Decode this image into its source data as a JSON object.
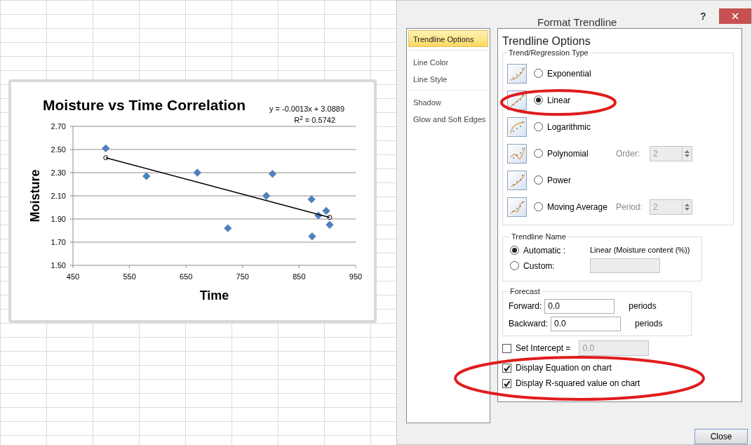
{
  "chart": {
    "title": "Moisture vs Time Correlation",
    "equation": "y = -0.0013x + 3.0889",
    "r_squared": "R$^{2}$ = 0.5742",
    "chart_data": {
      "type": "scatter",
      "xlabel": "Time",
      "ylabel": "Moisture",
      "xlim": [
        450,
        950
      ],
      "ylim": [
        1.5,
        2.7
      ],
      "xticks": [
        450,
        550,
        650,
        750,
        850,
        950
      ],
      "yticks": [
        {
          "value": 1.5,
          "label": "1.50"
        },
        {
          "value": 1.7,
          "label": "1.70"
        },
        {
          "value": 1.9,
          "label": "1.90"
        },
        {
          "value": 2.1,
          "label": "2.10"
        },
        {
          "value": 2.3,
          "label": "2.30"
        },
        {
          "value": 2.5,
          "label": "2.50"
        },
        {
          "value": 2.7,
          "label": "2.70"
        }
      ],
      "x": [
        508,
        580,
        670,
        724,
        792,
        803,
        872,
        873,
        884,
        898,
        904
      ],
      "grid": true,
      "series": [
        {
          "color": "#4f81bd",
          "values": [
            2.51,
            2.27,
            2.3,
            1.82,
            2.1,
            2.29,
            2.07,
            1.75,
            1.93,
            1.97,
            1.85
          ]
        },
        {
          "color": "#000000",
          "values": [
            2.429,
            null,
            null,
            null,
            null,
            null,
            null,
            null,
            null,
            null,
            1.914
          ]
        }
      ]
    }
  },
  "dialog": {
    "title": "Format Trendline",
    "help": "?",
    "nav_groups": [
      [
        {
          "label": "Trendline Options",
          "selected": true
        }
      ],
      [
        {
          "label": "Line Color",
          "selected": false
        },
        {
          "label": "Line Style",
          "selected": false
        }
      ],
      [
        {
          "label": "Shadow",
          "selected": false
        },
        {
          "label": "Glow and Soft Edges",
          "selected": false
        }
      ]
    ],
    "heading": "Trendline Options",
    "type_group": {
      "label": "Trend/Regression Type",
      "options": [
        {
          "label": "Exponential",
          "selected": false
        },
        {
          "label": "Linear",
          "selected": true
        },
        {
          "label": "Logarithmic",
          "selected": false
        },
        {
          "label": "Polynomial",
          "selected": false,
          "param": {
            "label": "Order:",
            "value": "2",
            "disabled": true
          }
        },
        {
          "label": "Power",
          "selected": false
        },
        {
          "label": "Moving Average",
          "selected": false,
          "param": {
            "label": "Period:",
            "value": "2",
            "disabled": true
          }
        }
      ]
    },
    "name_group": {
      "label": "Trendline Name",
      "options": [
        {
          "label": "Automatic :",
          "selected": true,
          "kind": "text",
          "value": "Linear (Moisture content (%))"
        },
        {
          "label": "Custom:",
          "selected": false,
          "kind": "field"
        }
      ]
    },
    "forecast": {
      "label": "Forecast",
      "rows": [
        {
          "label": "Forward:",
          "value": "0.0",
          "unit": "periods"
        },
        {
          "label": "Backward:",
          "value": "0.0",
          "unit": "periods"
        }
      ]
    },
    "checks": [
      {
        "label": "Set Intercept =",
        "checked": false,
        "value": "0.0",
        "disabled": true
      },
      {
        "label": "Display Equation on chart",
        "checked": true
      },
      {
        "label": "Display R-squared value on chart",
        "checked": true
      }
    ],
    "close_button": "Close"
  }
}
